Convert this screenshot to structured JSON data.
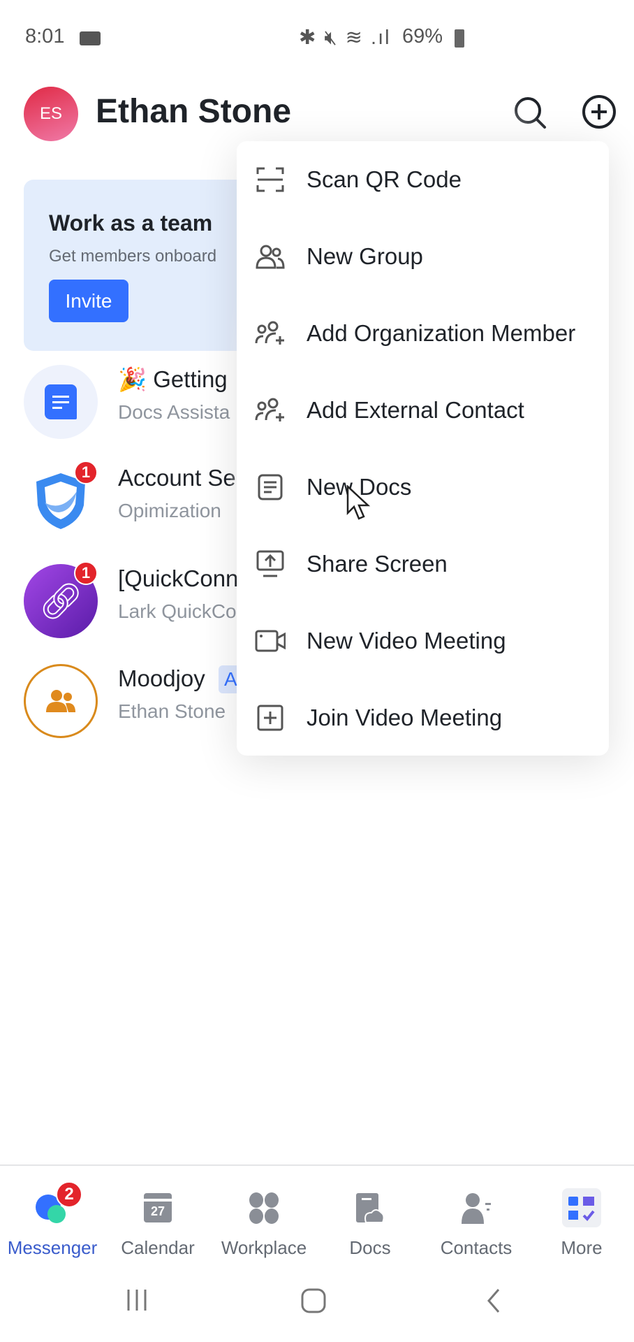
{
  "status_bar": {
    "time": "8:01",
    "battery": "69%"
  },
  "header": {
    "avatar_initials": "ES",
    "title": "Ethan Stone"
  },
  "banner": {
    "title": "Work as a team",
    "subtitle": "Get members onboard",
    "invite_label": "Invite"
  },
  "chats": [
    {
      "title": "🎉 Getting",
      "subtitle": "Docs Assista",
      "badge": null
    },
    {
      "title": "Account Se",
      "subtitle": "Opimization",
      "badge": "1"
    },
    {
      "title": "[QuickConn",
      "subtitle": "Lark QuickCo",
      "badge": "1"
    },
    {
      "title": "Moodjoy",
      "subtitle": "Ethan Stone",
      "tag": "A",
      "badge": null
    }
  ],
  "menu": {
    "items": [
      {
        "label": "Scan QR Code",
        "icon": "scan-icon"
      },
      {
        "label": "New Group",
        "icon": "group-icon"
      },
      {
        "label": "Add Organization Member",
        "icon": "add-member-icon"
      },
      {
        "label": "Add External Contact",
        "icon": "add-contact-icon"
      },
      {
        "label": "New Docs",
        "icon": "doc-icon"
      },
      {
        "label": "Share Screen",
        "icon": "share-screen-icon"
      },
      {
        "label": "New Video Meeting",
        "icon": "video-icon"
      },
      {
        "label": "Join Video Meeting",
        "icon": "join-icon"
      }
    ]
  },
  "tabs": [
    {
      "label": "Messenger",
      "active": true,
      "badge": "2"
    },
    {
      "label": "Calendar",
      "calendar_day": "27"
    },
    {
      "label": "Workplace"
    },
    {
      "label": "Docs"
    },
    {
      "label": "Contacts"
    },
    {
      "label": "More"
    }
  ],
  "colors": {
    "accent": "#3370ff",
    "badge": "#e3242b",
    "active_tab": "#3a5ccc"
  }
}
